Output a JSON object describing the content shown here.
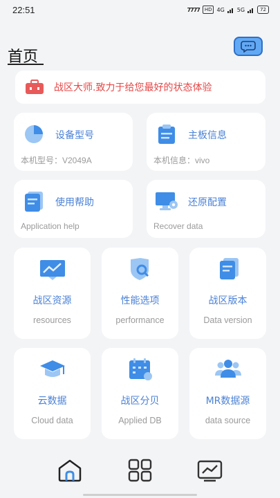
{
  "status_bar": {
    "time": "22:51",
    "indicators": "7777",
    "hd": "HD",
    "net1": "4G",
    "net2": "5G",
    "battery": "72"
  },
  "header": {
    "title": "首页",
    "chat_icon": "chat-bubble-icon"
  },
  "banner": {
    "icon": "toolbox-icon",
    "text": "战区大师.致力于给您最好的状态体验",
    "color": "#e64646"
  },
  "wide_cards": [
    {
      "label": "设备型号",
      "sub": "本机型号：V2049A",
      "icon": "pie-chart-icon"
    },
    {
      "label": "主板信息",
      "sub": "本机信息：vivo",
      "icon": "clipboard-icon"
    },
    {
      "label": "使用帮助",
      "sub": "Application help",
      "icon": "document-icon"
    },
    {
      "label": "还原配置",
      "sub": "Recover data",
      "icon": "monitor-settings-icon"
    }
  ],
  "grid_cards": [
    {
      "label": "战区资源",
      "sub": "resources",
      "icon": "trend-chart-icon"
    },
    {
      "label": "性能选项",
      "sub": "performance",
      "icon": "shield-search-icon"
    },
    {
      "label": "战区版本",
      "sub": "Data version",
      "icon": "document-icon"
    },
    {
      "label": "云数据",
      "sub": "Cloud data",
      "icon": "graduation-cap-icon"
    },
    {
      "label": "战区分贝",
      "sub": "Applied DB",
      "icon": "calendar-icon"
    },
    {
      "label": "MR数据源",
      "sub": "data source",
      "icon": "users-icon"
    }
  ],
  "bottom_nav": [
    {
      "icon": "home-icon"
    },
    {
      "icon": "grid-icon"
    },
    {
      "icon": "line-chart-icon"
    }
  ],
  "colors": {
    "accent": "#4b82d6",
    "icon_light": "#9cc6f4",
    "icon_dark": "#3f8de6",
    "background": "#f3f4f6"
  }
}
